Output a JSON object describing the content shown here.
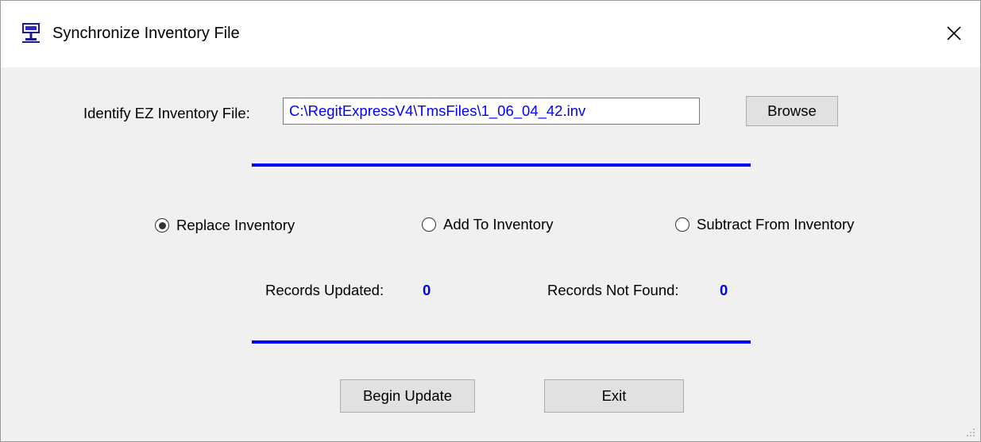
{
  "window": {
    "title": "Synchronize Inventory File"
  },
  "file": {
    "label": "Identify EZ Inventory File:",
    "path": "C:\\RegitExpressV4\\TmsFiles\\1_06_04_42.inv",
    "browse_label": "Browse"
  },
  "options": {
    "selected": "replace",
    "replace_label": "Replace Inventory",
    "add_label": "Add To Inventory",
    "subtract_label": "Subtract From Inventory"
  },
  "stats": {
    "updated_label": "Records Updated:",
    "updated_value": "0",
    "notfound_label": "Records Not Found:",
    "notfound_value": "0"
  },
  "actions": {
    "begin_label": "Begin Update",
    "exit_label": "Exit"
  },
  "colors": {
    "accent": "#0000ff",
    "window_bg": "#f0f0f0",
    "button_bg": "#e1e1e1"
  },
  "icons": {
    "app": "computer-monitor-icon",
    "close": "close-icon",
    "grip": "resize-grip-icon"
  }
}
